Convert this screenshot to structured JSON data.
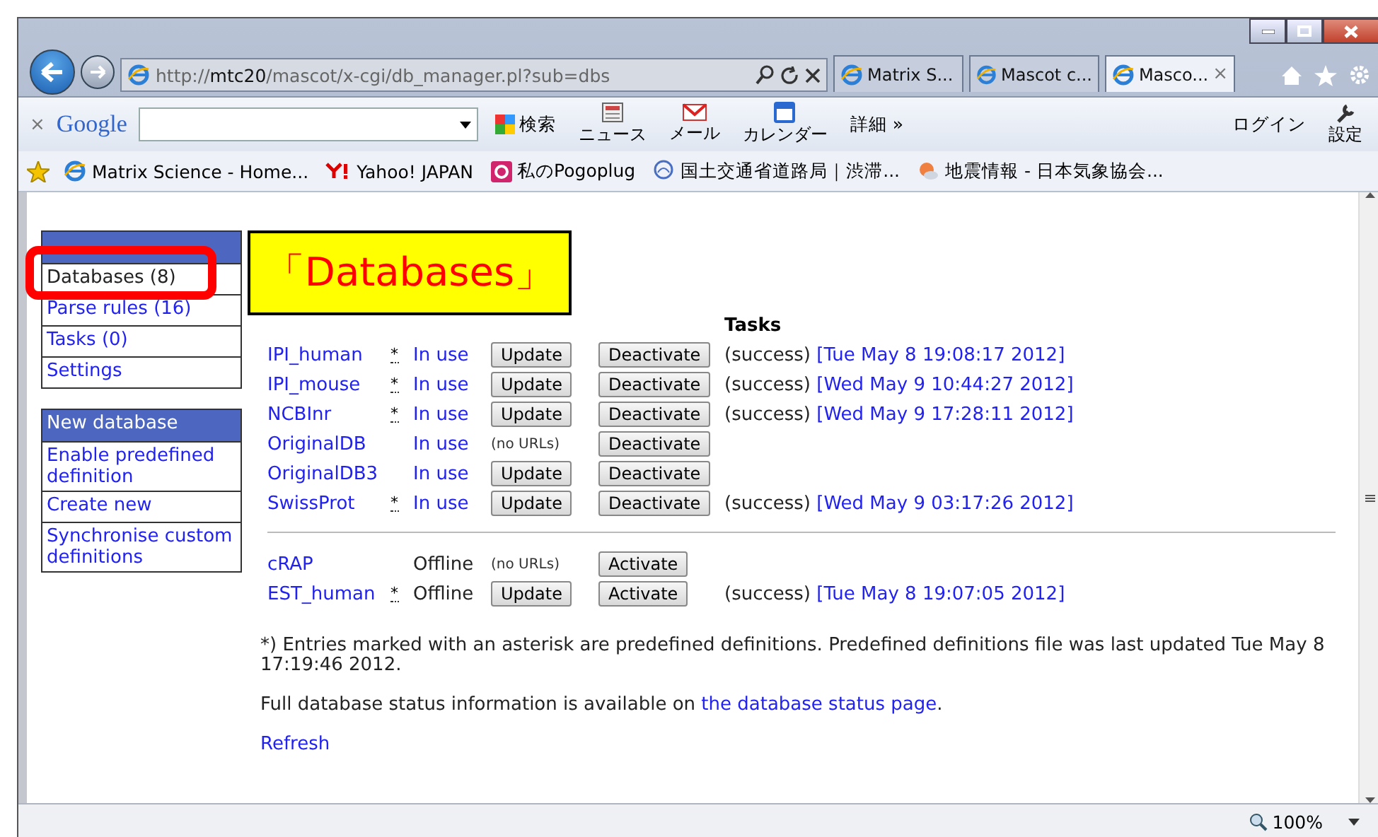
{
  "browser": {
    "address": {
      "scheme": "http://",
      "host": "mtc20",
      "path": "/mascot/x-cgi/db_manager.pl?sub=dbs"
    },
    "tabs": [
      {
        "label": "Matrix S...",
        "selected": false
      },
      {
        "label": "Mascot c...",
        "selected": false
      },
      {
        "label": "Masco...",
        "selected": true
      }
    ],
    "tab_close": "×"
  },
  "google_toolbar": {
    "close": "×",
    "logo": "Google",
    "search": "検索",
    "items": [
      {
        "label": "ニュース",
        "kind": "news"
      },
      {
        "label": "メール",
        "kind": "mail"
      },
      {
        "label": "カレンダー",
        "kind": "calendar"
      }
    ],
    "more": "詳細 »",
    "login": "ログイン",
    "settings": "設定"
  },
  "favorites": [
    {
      "label": "Matrix Science - Home...",
      "kind": "page"
    },
    {
      "label": "Yahoo! JAPAN",
      "kind": "yahoo"
    },
    {
      "label": "私のPogoplug",
      "kind": "pogoplug"
    },
    {
      "label": "国土交通省道路局｜渋滞...",
      "kind": "ministry"
    },
    {
      "label": "地震情報 - 日本気象協会...",
      "kind": "weather"
    }
  ],
  "sidebar": [
    {
      "items": [
        {
          "label": "Databases (8)",
          "selected": true
        },
        {
          "label": "Parse rules (16)",
          "selected": false
        },
        {
          "label": "Tasks (0)",
          "selected": false
        },
        {
          "label": "Settings",
          "selected": false
        }
      ]
    },
    {
      "header": "New database",
      "items": [
        {
          "label": "Enable predefined definition",
          "selected": false
        },
        {
          "label": "Create new",
          "selected": false
        },
        {
          "label": "Synchronise custom definitions",
          "selected": false
        }
      ]
    }
  ],
  "callout": "「Databases」",
  "table": {
    "tasks_header": "Tasks",
    "groups": [
      [
        {
          "name": "IPI_human",
          "star": "*",
          "status": "In use",
          "online": true,
          "new_files": {
            "kind": "button",
            "label": "Update"
          },
          "action": "Deactivate",
          "result": "(success)",
          "date": "[Tue May 8 19:08:17 2012]"
        },
        {
          "name": "IPI_mouse",
          "star": "*",
          "status": "In use",
          "online": true,
          "new_files": {
            "kind": "button",
            "label": "Update"
          },
          "action": "Deactivate",
          "result": "(success)",
          "date": "[Wed May 9 10:44:27 2012]"
        },
        {
          "name": "NCBInr",
          "star": "*",
          "status": "In use",
          "online": true,
          "new_files": {
            "kind": "button",
            "label": "Update"
          },
          "action": "Deactivate",
          "result": "(success)",
          "date": "[Wed May 9 17:28:11 2012]"
        },
        {
          "name": "OriginalDB",
          "status": "In use",
          "online": true,
          "new_files": {
            "kind": "note",
            "label": "(no URLs)"
          },
          "action": "Deactivate"
        },
        {
          "name": "OriginalDB3",
          "status": "In use",
          "online": true,
          "new_files": {
            "kind": "button",
            "label": "Update"
          },
          "action": "Deactivate"
        },
        {
          "name": "SwissProt",
          "star": "*",
          "status": "In use",
          "online": true,
          "new_files": {
            "kind": "button",
            "label": "Update"
          },
          "action": "Deactivate",
          "result": "(success)",
          "date": "[Wed May 9 03:17:26 2012]"
        }
      ],
      [
        {
          "name": "cRAP",
          "status": "Offline",
          "online": false,
          "new_files": {
            "kind": "note",
            "label": "(no URLs)"
          },
          "action": "Activate"
        },
        {
          "name": "EST_human",
          "star": "*",
          "status": "Offline",
          "online": false,
          "new_files": {
            "kind": "button",
            "label": "Update"
          },
          "action": "Activate",
          "result": "(success)",
          "date": "[Tue May 8 19:07:05 2012]"
        }
      ]
    ]
  },
  "footnote": "*) Entries marked with an asterisk are predefined definitions. Predefined definitions file was last updated Tue May 8 17:19:46 2012.",
  "status_info": {
    "text": "Full database status information is available on ",
    "link": "the database status page",
    "end": "."
  },
  "refresh": "Refresh",
  "status_bar": {
    "zoom": "100%"
  }
}
